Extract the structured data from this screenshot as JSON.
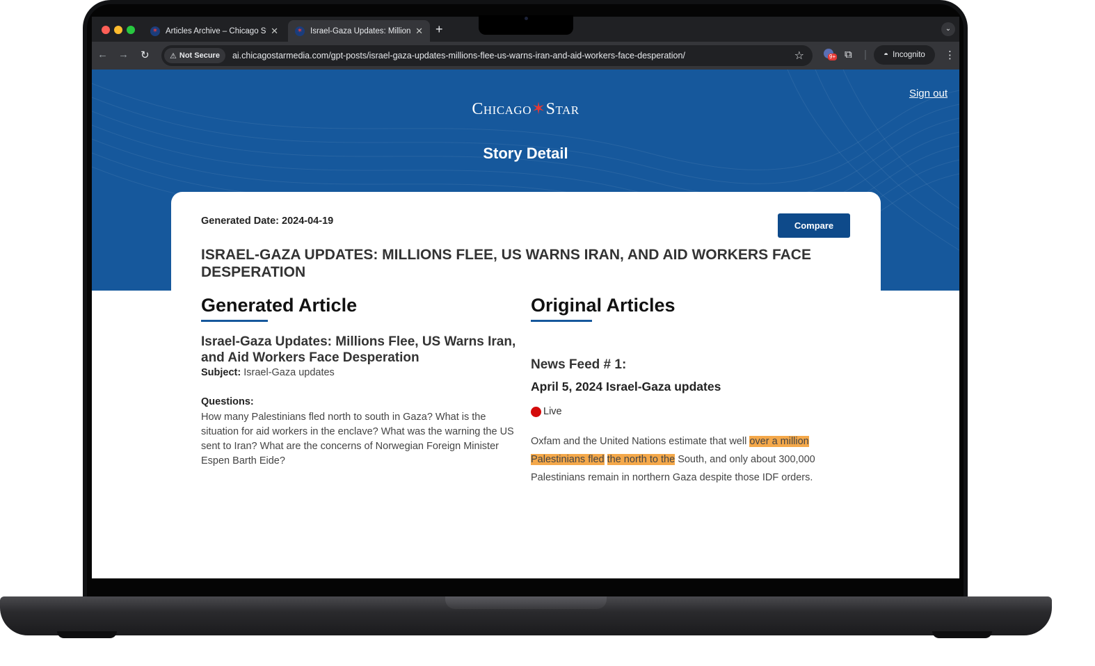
{
  "browser": {
    "tabs": [
      {
        "title": "Articles Archive – Chicago St",
        "active": false
      },
      {
        "title": "Israel-Gaza Updates: Million",
        "active": true
      }
    ],
    "security_label": "Not Secure",
    "url": "ai.chicagostarmedia.com/gpt-posts/israel-gaza-updates-millions-flee-us-warns-iran-and-aid-workers-face-desperation/",
    "extension_badge": "9+",
    "incognito_label": "Incognito"
  },
  "site": {
    "logo_left": "Chicago",
    "logo_star": "✶",
    "logo_right": "Star",
    "sign_out": "Sign out",
    "page_title": "Story Detail"
  },
  "story": {
    "generated_date": "Generated Date: 2024-04-19",
    "compare_label": "Compare",
    "headline": "ISRAEL-GAZA UPDATES: MILLIONS FLEE, US WARNS IRAN, AND AID WORKERS FACE DESPERATION",
    "generated_heading": "Generated Article",
    "original_heading": "Original Articles",
    "article_title": "Israel-Gaza Updates: Millions Flee, US Warns Iran, and Aid Workers Face Desperation",
    "subject_label": "Subject:",
    "subject_value": "Israel-Gaza updates",
    "questions_label": "Questions:",
    "questions": "How many Palestinians fled north to south in Gaza? What is the situation for aid workers in the enclave? What was the warning the US sent to Iran? What are the concerns of Norwegian Foreign Minister Espen Barth Eide?",
    "feed_label": "News Feed # 1:",
    "feed_date": "April 5, 2024 Israel-Gaza updates",
    "live_label": "Live",
    "body_part1": "Oxfam and the United Nations estimate that well ",
    "body_hl1": "over a million Palestinians fled",
    "body_space": " ",
    "body_hl2": "the north to the",
    "body_part2": " South, and only about 300,000 Palestinians remain in northern Gaza despite those IDF orders."
  },
  "colors": {
    "hero_blue": "#16589c",
    "button_blue": "#0e4a8a",
    "highlight": "#f4a84a",
    "live_red": "#d40b0b"
  }
}
